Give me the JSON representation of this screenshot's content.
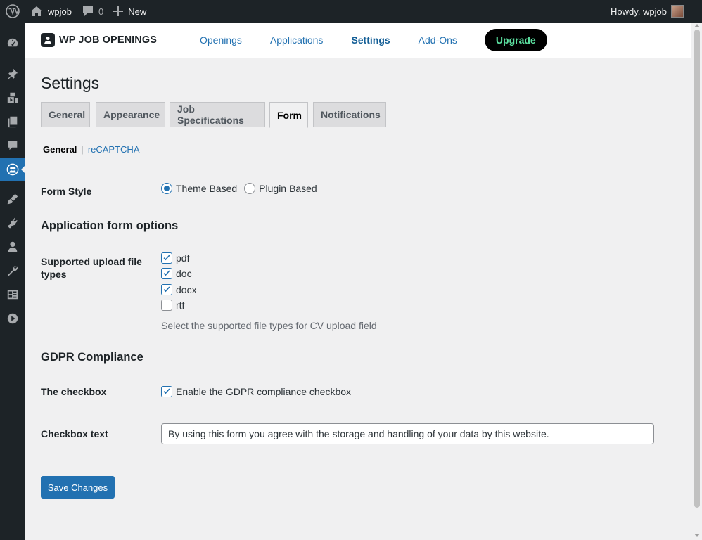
{
  "adminbar": {
    "site_name": "wpjob",
    "comments_count": "0",
    "new_label": "New",
    "greeting": "Howdy, wpjob"
  },
  "admin_menu": {
    "items": [
      "dashboard-icon",
      "posts-icon",
      "media-icon",
      "pages-icon",
      "comments-icon",
      "job-openings-icon",
      "appearance-icon",
      "plugins-icon",
      "users-icon",
      "tools-icon",
      "settings-icon",
      "media-play-icon"
    ],
    "current": "job-openings-icon"
  },
  "plugin_header": {
    "logo_text": "WP JOB OPENINGS",
    "nav": [
      {
        "label": "Openings"
      },
      {
        "label": "Applications"
      },
      {
        "label": "Settings"
      },
      {
        "label": "Add-Ons"
      }
    ],
    "active_nav": "Settings",
    "upgrade_label": "Upgrade"
  },
  "page": {
    "title": "Settings",
    "tabs": [
      "General",
      "Appearance",
      "Job Specifications",
      "Form",
      "Notifications"
    ],
    "active_tab": "Form",
    "subnav": {
      "current": "General",
      "separator": "|",
      "link": "reCAPTCHA"
    }
  },
  "form": {
    "form_style_label": "Form Style",
    "form_style_options": [
      "Theme Based",
      "Plugin Based"
    ],
    "form_style_selected": "Theme Based",
    "app_options_heading": "Application form options",
    "upload_types_label_line1": "Supported upload file",
    "upload_types_label_line2": "types",
    "file_types": [
      {
        "label": "pdf",
        "checked": true
      },
      {
        "label": "doc",
        "checked": true
      },
      {
        "label": "docx",
        "checked": true
      },
      {
        "label": "rtf",
        "checked": false
      }
    ],
    "file_types_description": "Select the supported file types for CV upload field",
    "gdpr_heading": "GDPR Compliance",
    "checkbox_label": "The checkbox",
    "gdpr_checkbox_text": "Enable the GDPR compliance checkbox",
    "gdpr_checkbox_checked": true,
    "checkbox_text_label": "Checkbox text",
    "checkbox_text_value": "By using this form you agree with the storage and handling of your data by this website.",
    "save_label": "Save Changes"
  },
  "colors": {
    "admin_bar": "#1d2327",
    "accent": "#2271b1",
    "upgrade_bg": "#000000",
    "upgrade_text": "#5ce0a0"
  }
}
